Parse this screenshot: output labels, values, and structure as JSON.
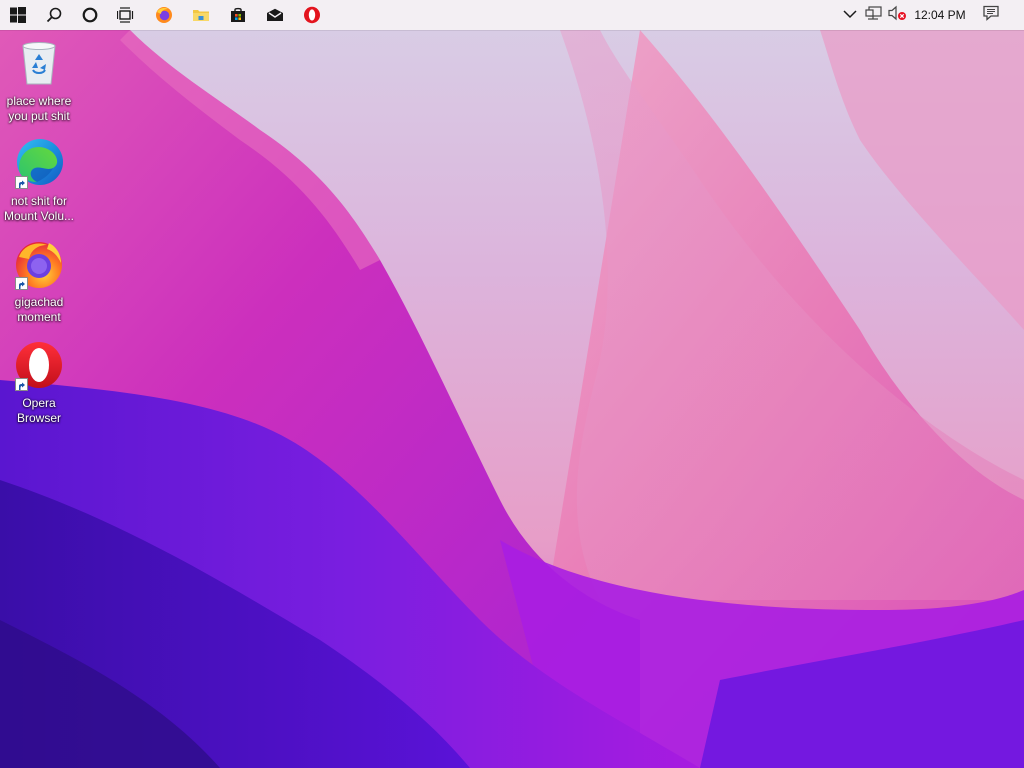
{
  "taskbar": {
    "buttons": [
      {
        "name": "start",
        "icon": "windows-logo-icon"
      },
      {
        "name": "search",
        "icon": "search-icon"
      },
      {
        "name": "cortana",
        "icon": "cortana-circle-icon"
      },
      {
        "name": "task-view",
        "icon": "task-view-icon"
      },
      {
        "name": "firefox",
        "icon": "firefox-icon"
      },
      {
        "name": "file-explorer",
        "icon": "folder-icon"
      },
      {
        "name": "store",
        "icon": "store-bag-icon"
      },
      {
        "name": "mail",
        "icon": "mail-icon"
      },
      {
        "name": "opera",
        "icon": "opera-icon"
      }
    ],
    "tray": {
      "chevron_icon": "chevron-up-icon",
      "network_icon": "network-disconnected-icon",
      "volume_icon": "volume-muted-icon",
      "clock": "12:04 PM",
      "notifications_icon": "action-center-icon"
    },
    "colors": {
      "background": "#f4f0f4",
      "icon": "#1a1a1a"
    }
  },
  "desktop": {
    "icons": [
      {
        "label": "place where\nyou put shit",
        "icon": "recycle-bin-icon",
        "shortcut": false
      },
      {
        "label": "not shit for\nMount Volu...",
        "icon": "edge-icon",
        "shortcut": true
      },
      {
        "label": "gigachad\nmoment",
        "icon": "firefox-icon",
        "shortcut": true
      },
      {
        "label": "Opera\nBrowser",
        "icon": "opera-icon",
        "shortcut": true
      }
    ],
    "wallpaper_colors": [
      "#e9d6ec",
      "#e062c2",
      "#c624b6",
      "#8a18dc",
      "#5511d6",
      "#3a0ea8"
    ]
  }
}
